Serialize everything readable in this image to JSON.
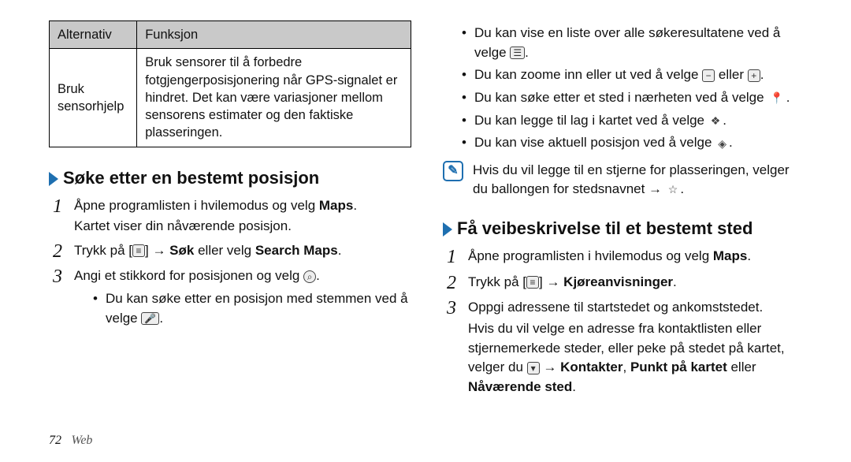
{
  "table": {
    "headers": [
      "Alternativ",
      "Funksjon"
    ],
    "row": {
      "alt": "Bruk sensorhjelp",
      "func": "Bruk sensorer til å forbedre fotgjengerposisjonering når GPS-signalet er hindret. Det kan være variasjoner mellom sensorens estimater og den faktiske plasseringen."
    }
  },
  "sec1": {
    "title": "Søke etter en bestemt posisjon",
    "step1a": "Åpne programlisten i hvilemodus og velg ",
    "step1a_bold": "Maps",
    "step1a_tail": ".",
    "step1b": "Kartet viser din nåværende posisjon.",
    "step2_pre": "Trykk på [",
    "step2_mid": "] → ",
    "step2_b1": "Søk",
    "step2_mid2": " eller velg ",
    "step2_b2": "Search Maps",
    "step2_tail": ".",
    "step3_pre": "Angi et stikkord for posisjonen og velg ",
    "step3_tail": ".",
    "bullet_pre": "Du kan søke etter en posisjon med stemmen ved å velge ",
    "bullet_tail": "."
  },
  "right_bullets": {
    "b1_pre": "Du kan vise en liste over alle søkeresultatene ved å velge ",
    "b1_tail": ".",
    "b2_pre": "Du kan zoome inn eller ut ved å velge ",
    "b2_mid": " eller ",
    "b2_tail": ".",
    "b3_pre": "Du kan søke etter et sted i nærheten ved å velge ",
    "b3_tail": ".",
    "b4_pre": "Du kan legge til lag i kartet ved å velge ",
    "b4_tail": ".",
    "b5_pre": "Du kan vise aktuell posisjon ved å velge ",
    "b5_tail": "."
  },
  "note": {
    "text_pre": "Hvis du vil legge til en stjerne for plasseringen, velger du ballongen for stedsnavnet → ",
    "text_tail": "."
  },
  "sec2": {
    "title": "Få veibeskrivelse til et bestemt sted",
    "step1_pre": "Åpne programlisten i hvilemodus og velg ",
    "step1_bold": "Maps",
    "step1_tail": ".",
    "step2_pre": "Trykk på [",
    "step2_mid": "] → ",
    "step2_bold": "Kjøreanvisninger",
    "step2_tail": ".",
    "step3": "Oppgi adressene til startstedet og ankomststedet.",
    "step3_p2_pre": "Hvis du vil velge en adresse fra kontaktlisten eller stjernemerkede steder, eller peke på stedet på kartet, velger du ",
    "step3_p2_mid": " → ",
    "step3_p2_b1": "Kontakter",
    "step3_p2_sep": ", ",
    "step3_p2_b2": "Punkt på kartet",
    "step3_p2_mid2": " eller ",
    "step3_p2_b3": "Nåværende sted",
    "step3_p2_tail": "."
  },
  "footer": {
    "page": "72",
    "chapter": "Web"
  }
}
